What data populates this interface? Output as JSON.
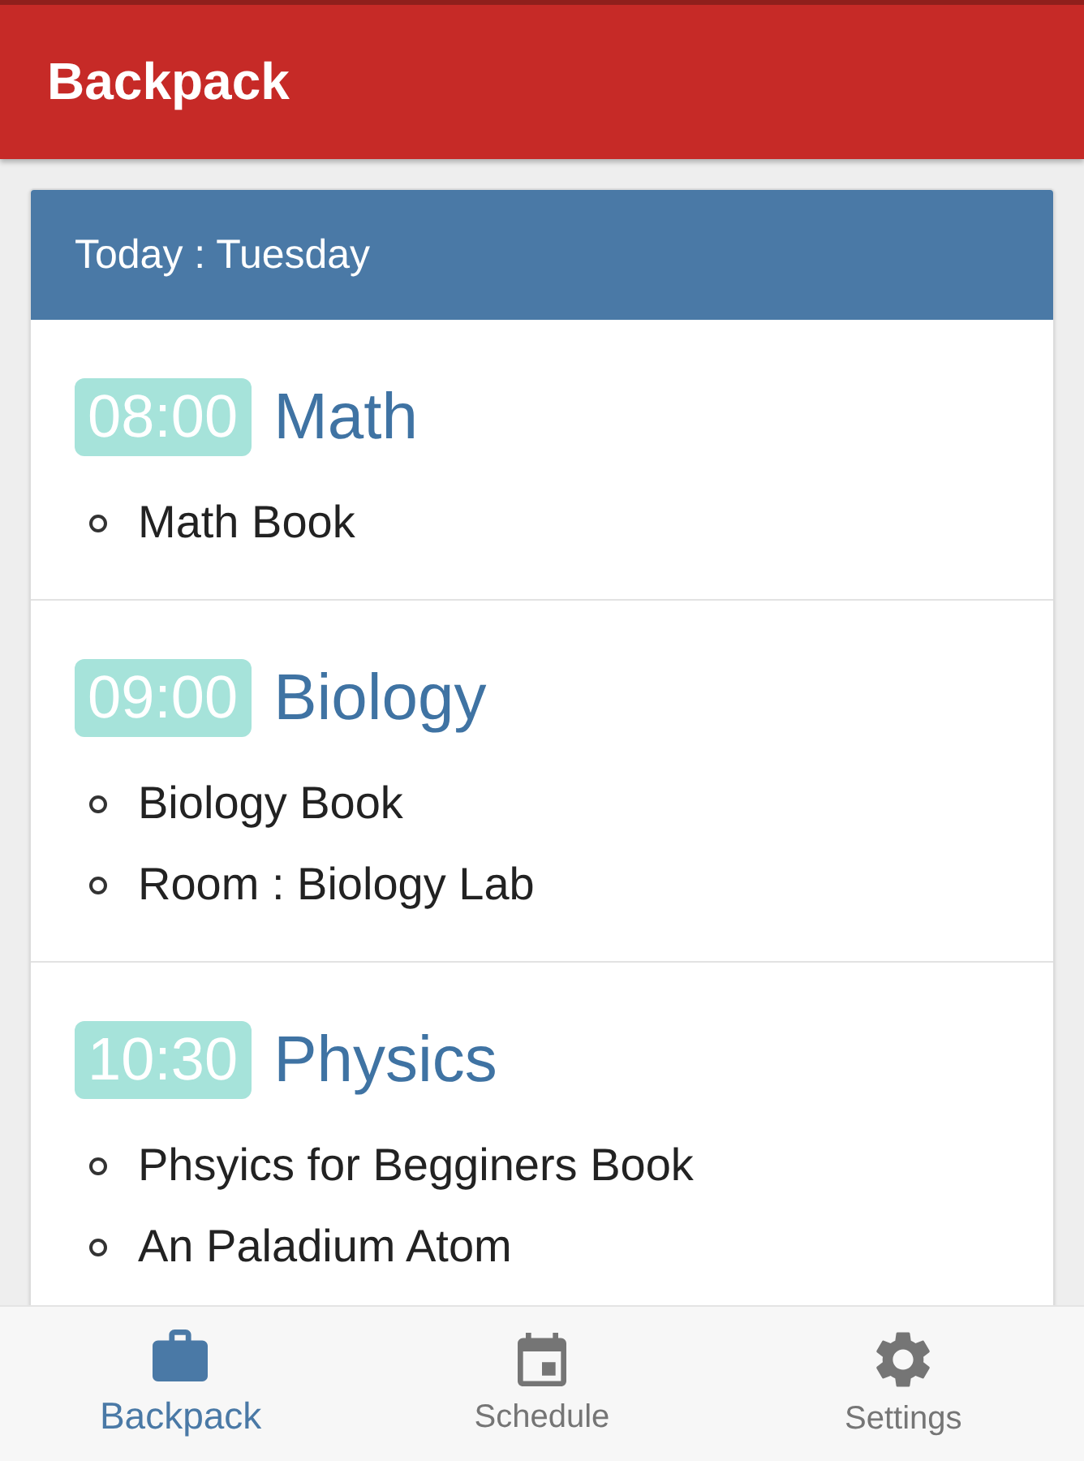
{
  "app_bar": {
    "title": "Backpack"
  },
  "day_card": {
    "title": "Today : Tuesday",
    "lessons": [
      {
        "time": "08:00",
        "subject": "Math",
        "items": [
          "Math Book"
        ]
      },
      {
        "time": "09:00",
        "subject": "Biology",
        "items": [
          "Biology Book",
          "Room : Biology Lab"
        ]
      },
      {
        "time": "10:30",
        "subject": "Physics",
        "items": [
          "Phsyics for Begginers Book",
          "An Paladium Atom"
        ]
      }
    ]
  },
  "bottom_nav": {
    "items": [
      {
        "label": "Backpack",
        "selected": true
      },
      {
        "label": "Schedule",
        "selected": false
      },
      {
        "label": "Settings",
        "selected": false
      }
    ]
  }
}
